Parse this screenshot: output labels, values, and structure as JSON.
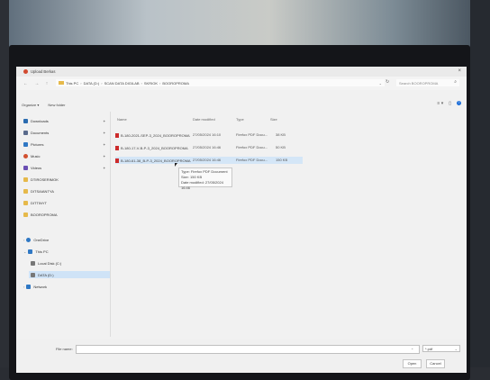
{
  "window": {
    "title": "Upload Berkas"
  },
  "address": {
    "nav_label": "← → ↑",
    "path": [
      "This PC",
      "DATA (D:)",
      "SCAN DATA DIGILAB",
      "SKRIOK",
      "BOOROPROMA"
    ],
    "search_placeholder": "Search BOOROPROMA"
  },
  "toolbar": {
    "organize": "Organize ▾",
    "new_folder": "New folder"
  },
  "sidebar": {
    "quick": [
      {
        "label": "Downloads",
        "color": "#2b6cb0"
      },
      {
        "label": "Documents",
        "color": "#5a6b8c"
      },
      {
        "label": "Pictures",
        "color": "#2f78c4"
      },
      {
        "label": "Music",
        "color": "#d2502f"
      },
      {
        "label": "Videos",
        "color": "#6b4fb3"
      },
      {
        "label": "DTIROSERIMOK",
        "color": "#e6b94a"
      },
      {
        "label": "DITSAIANTYA",
        "color": "#e6b94a"
      },
      {
        "label": "DITTINYT",
        "color": "#e6b94a"
      },
      {
        "label": "BOOROPROMA",
        "color": "#e6b94a"
      }
    ],
    "tree": [
      {
        "label": "OneDrive",
        "color": "#2f78c4"
      },
      {
        "label": "This PC",
        "color": "#2f78c4"
      },
      {
        "label": "Local Disk (C:)",
        "color": "#777777"
      },
      {
        "label": "DATA (D:)",
        "color": "#777777"
      },
      {
        "label": "Network",
        "color": "#2f78c4"
      }
    ]
  },
  "columns": {
    "name": "Name",
    "date": "Date modified",
    "type": "Type",
    "size": "Size"
  },
  "files": [
    {
      "name": "B-180-2021-SEP-3_2024_BOOROPROMA",
      "date": "27/05/2024 16:10",
      "type": "Firefox PDF Docu...",
      "size": "38 KB"
    },
    {
      "name": "B-180-17-V-B-P-3_2024_BOOROPROMA",
      "date": "27/05/2024 16:46",
      "type": "Firefox PDF Docu...",
      "size": "50 KB"
    },
    {
      "name": "B-180-61-38_B-P-3_2024_BOOROPROMA",
      "date": "27/05/2024 16:46",
      "type": "Firefox PDF Docu...",
      "size": "150 KB"
    }
  ],
  "tooltip": {
    "type": "Type: Firefox PDF Document",
    "size": "Size: 150 KB",
    "date": "Date modified: 27/05/2024 16:46"
  },
  "bottom": {
    "file_name_label": "File name:",
    "file_type": "*.pdf",
    "open": "Open",
    "cancel": "Cancel"
  }
}
